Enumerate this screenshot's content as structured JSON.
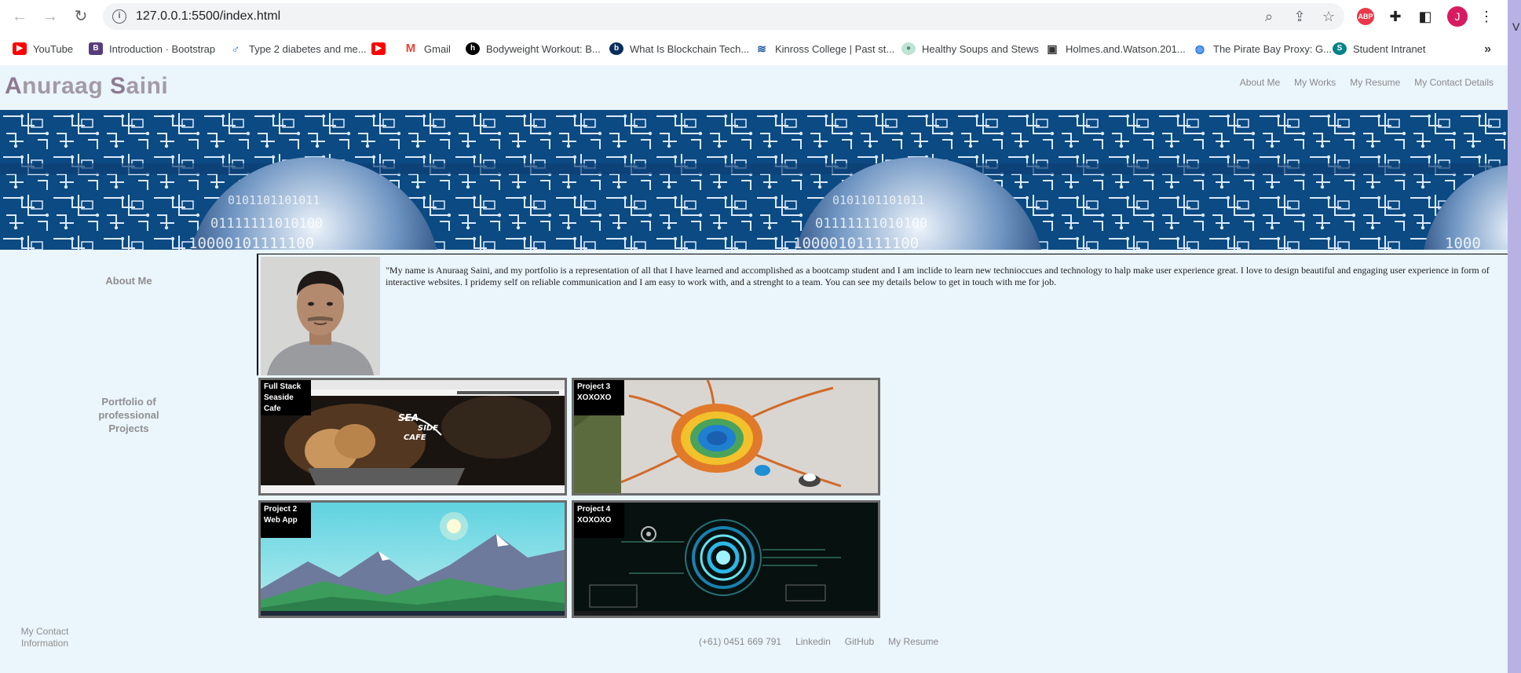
{
  "browser": {
    "url": "127.0.0.1:5500/index.html",
    "profile_initial": "J",
    "abp_label": "ABP",
    "bookmarks": [
      {
        "label": "YouTube",
        "icon": "youtube-icon",
        "color": "#ff0000"
      },
      {
        "label": "Introduction · Bootstrap",
        "icon": "bootstrap-icon",
        "color": "#563d7c"
      },
      {
        "label": "Type 2 diabetes and me...",
        "icon": "health-icon",
        "color": "#1a73e8"
      },
      {
        "label": "",
        "icon": "youtube-icon",
        "color": "#ff0000"
      },
      {
        "label": "Gmail",
        "icon": "gmail-icon",
        "color": "#ea4335"
      },
      {
        "label": "Bodyweight Workout: B...",
        "icon": "workout-icon",
        "color": "#000000"
      },
      {
        "label": "What Is Blockchain Tech...",
        "icon": "blockchain-icon",
        "color": "#0a2e5c"
      },
      {
        "label": "Kinross College | Past st...",
        "icon": "college-icon",
        "color": "#1e56a0"
      },
      {
        "label": "Healthy Soups and Stews",
        "icon": "soup-icon",
        "color": "#7ab89c"
      },
      {
        "label": "Holmes.and.Watson.201...",
        "icon": "movie-icon",
        "color": "#333333"
      },
      {
        "label": "The Pirate Bay Proxy: G...",
        "icon": "globe-icon",
        "color": "#1a73e8"
      },
      {
        "label": "Student Intranet",
        "icon": "sharepoint-icon",
        "color": "#038387"
      }
    ]
  },
  "site": {
    "brand_first_cap": "A",
    "brand_first_rest": "nuraag ",
    "brand_last_cap": "S",
    "brand_last_rest": "aini",
    "nav": [
      "About Me",
      "My Works",
      "My Resume",
      "My Contact Details"
    ]
  },
  "sections": {
    "about_label": "About Me",
    "portfolio_label": "Portfolio of professional Projects",
    "contact_label": "My Contact Information"
  },
  "about": {
    "text": "\"My name is Anuraag Saini, and my portfolio is a representation of all that I have learned and accomplished as a bootcamp student and I am inclide to learn new technioccues and technology to halp make user experience great. I love to design beautiful and engaging user experience in form of interactive websites. I pridemy self on reliable communication and I am easy to work with, and a strenght to a team. You can see my details below to get in touch with me for job."
  },
  "projects": [
    {
      "line1": "Full Stack",
      "line2": "Seaside Cafe",
      "sign": [
        "SEA",
        "SIDE",
        "CAFE"
      ]
    },
    {
      "line1": "Project 3",
      "line2": "XOXOXO"
    },
    {
      "line1": "Project 2",
      "line2": "Web App"
    },
    {
      "line1": "Project 4",
      "line2": "XOXOXO"
    }
  ],
  "footer": [
    "(+61) 0451 669 791",
    "Linkedin",
    "GitHub",
    "My Resume"
  ],
  "colors": {
    "page_bg": "#eaf5fc",
    "brand": "#a29aa4",
    "nav_text": "#8a8a8a",
    "banner": "#0a3d6e"
  }
}
